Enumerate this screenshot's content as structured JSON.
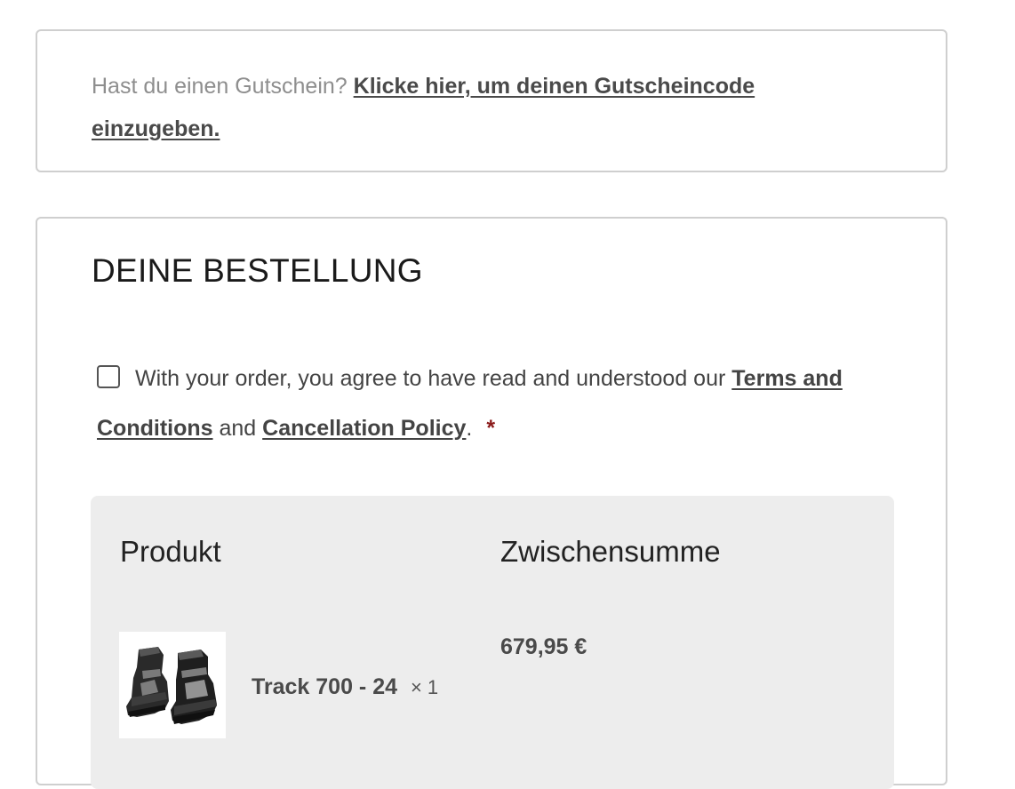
{
  "coupon": {
    "prompt": "Hast du einen Gutschein?",
    "link": "Klicke hier, um deinen Gutscheincode einzugeben."
  },
  "order": {
    "title": "DEINE BESTELLUNG",
    "terms": {
      "checked": false,
      "text_before": "With your order, you agree to have read and understood our",
      "terms_link": "Terms and Conditions",
      "and_text": "and",
      "cancellation_link": "Cancellation Policy",
      "period": ".",
      "required_marker": "*"
    },
    "table": {
      "headers": {
        "product": "Produkt",
        "subtotal": "Zwischensumme"
      },
      "items": [
        {
          "name": "Track 700 - 24",
          "quantity": "× 1",
          "price": "679,95 €",
          "image_icon": "ski-boots-image"
        }
      ]
    }
  },
  "colors": {
    "required": "#8b1a1a",
    "summary_background": "#ededed",
    "border": "#cfcfcf"
  }
}
